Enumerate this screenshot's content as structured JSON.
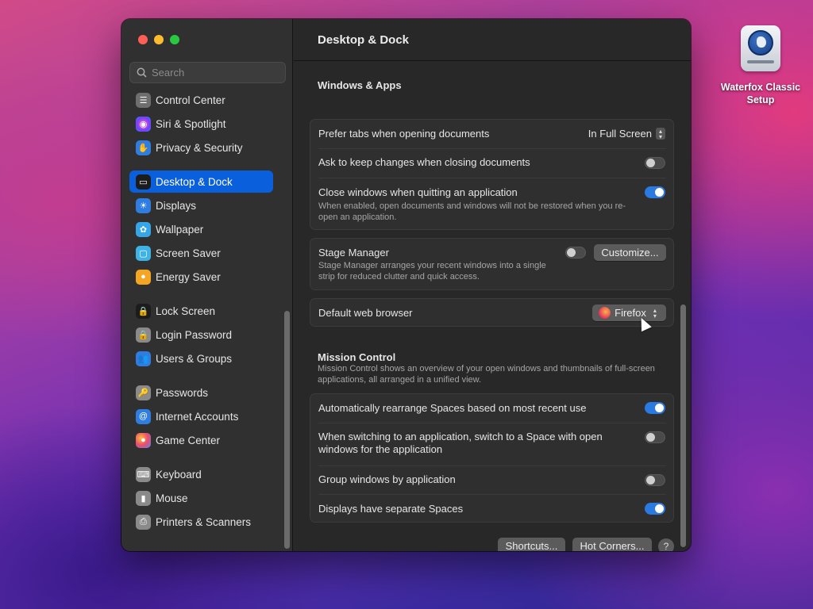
{
  "desktop": {
    "icon_label": "Waterfox Classic Setup",
    "icon": "drive-globe-icon"
  },
  "window": {
    "title": "Desktop & Dock"
  },
  "search": {
    "placeholder": "Search"
  },
  "sidebar": {
    "items": [
      {
        "label": "Control Center",
        "icon": "control-center-icon",
        "color": "#6e6e6e"
      },
      {
        "label": "Siri & Spotlight",
        "icon": "siri-icon",
        "color": "#b03ad6"
      },
      {
        "label": "Privacy & Security",
        "icon": "hand-icon",
        "color": "#2f7de1"
      },
      {
        "label": "Desktop & Dock",
        "icon": "dock-icon",
        "color": "#1c1c1c",
        "selected": true
      },
      {
        "label": "Displays",
        "icon": "sun-icon",
        "color": "#2f7de1"
      },
      {
        "label": "Wallpaper",
        "icon": "flower-icon",
        "color": "#35a7e8"
      },
      {
        "label": "Screen Saver",
        "icon": "screensaver-icon",
        "color": "#3fb3e6"
      },
      {
        "label": "Energy Saver",
        "icon": "bulb-icon",
        "color": "#f4a623"
      },
      {
        "label": "Lock Screen",
        "icon": "lock-icon",
        "color": "#1c1c1c"
      },
      {
        "label": "Login Password",
        "icon": "lock-closed-icon",
        "color": "#8a8a8a"
      },
      {
        "label": "Users & Groups",
        "icon": "users-icon",
        "color": "#2f7de1"
      },
      {
        "label": "Passwords",
        "icon": "key-icon",
        "color": "#8a8a8a"
      },
      {
        "label": "Internet Accounts",
        "icon": "at-icon",
        "color": "#2f7de1"
      },
      {
        "label": "Game Center",
        "icon": "game-center-icon",
        "color": "#ffffff"
      },
      {
        "label": "Keyboard",
        "icon": "keyboard-icon",
        "color": "#8a8a8a"
      },
      {
        "label": "Mouse",
        "icon": "mouse-icon",
        "color": "#8a8a8a"
      },
      {
        "label": "Printers & Scanners",
        "icon": "printer-icon",
        "color": "#8a8a8a"
      }
    ]
  },
  "windows_apps": {
    "title": "Windows & Apps",
    "prefer_tabs": {
      "label": "Prefer tabs when opening documents",
      "value": "In Full Screen"
    },
    "ask_keep": {
      "label": "Ask to keep changes when closing documents",
      "on": false
    },
    "close_windows": {
      "label": "Close windows when quitting an application",
      "desc": "When enabled, open documents and windows will not be restored when you re-open an application.",
      "on": true
    },
    "stage_manager": {
      "label": "Stage Manager",
      "desc": "Stage Manager arranges your recent windows into a single strip for reduced clutter and quick access.",
      "on": false,
      "button": "Customize..."
    },
    "default_browser": {
      "label": "Default web browser",
      "value": "Firefox"
    }
  },
  "mission_control": {
    "title": "Mission Control",
    "desc": "Mission Control shows an overview of your open windows and thumbnails of full-screen applications, all arranged in a unified view.",
    "rearrange": {
      "label": "Automatically rearrange Spaces based on most recent use",
      "on": true
    },
    "switch_space": {
      "label": "When switching to an application, switch to a Space with open windows for the application",
      "on": false
    },
    "group_windows": {
      "label": "Group windows by application",
      "on": false
    },
    "separate_spaces": {
      "label": "Displays have separate Spaces",
      "on": true
    }
  },
  "footer": {
    "shortcuts": "Shortcuts...",
    "hot_corners": "Hot Corners...",
    "help": "?"
  }
}
